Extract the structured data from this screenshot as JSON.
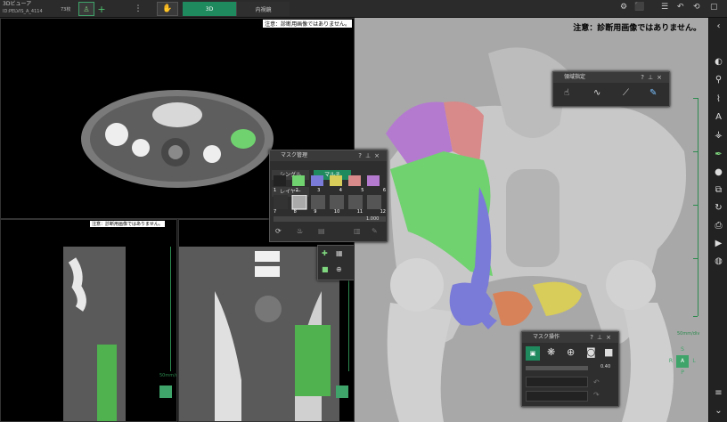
{
  "app": {
    "title": "3Dビューア",
    "patient_id": "ID:PELVIS_A_4114",
    "series_count": "73枚"
  },
  "tabs": [
    {
      "label": "3D",
      "active": true
    },
    {
      "label": "内視鏡",
      "active": false
    }
  ],
  "viewports": {
    "warning_text": "注意：診断用画像ではありません。",
    "warning_text_small": "注意：診断用画像ではありません。",
    "scale_label": "50mm/div"
  },
  "orientation": {
    "top": "S",
    "left": "R",
    "center": "A",
    "right": "L",
    "bottom": "P"
  },
  "mask_panel": {
    "title": "マスク管理",
    "modes": [
      "シングル",
      "マルチ",
      "レイヤー"
    ],
    "active_mode": "マルチ",
    "row1_numbers": [
      "1",
      "2",
      "3",
      "4",
      "5",
      "6"
    ],
    "row2_numbers": [
      "7",
      "8",
      "9",
      "10",
      "11",
      "12"
    ],
    "value": "1.000"
  },
  "region_panel": {
    "title": "領域指定"
  },
  "mask_op_panel": {
    "title": "マスク操作",
    "value": "0.40"
  },
  "colors": {
    "accent": "#1f8a5e",
    "mask_green": "#6fd26f",
    "bone_purple": "#b47ad0",
    "bone_pink": "#d88a8a",
    "bone_blue": "#7a7ad8",
    "bone_yellow": "#d8cc5a",
    "bone_orange": "#d8825a"
  }
}
